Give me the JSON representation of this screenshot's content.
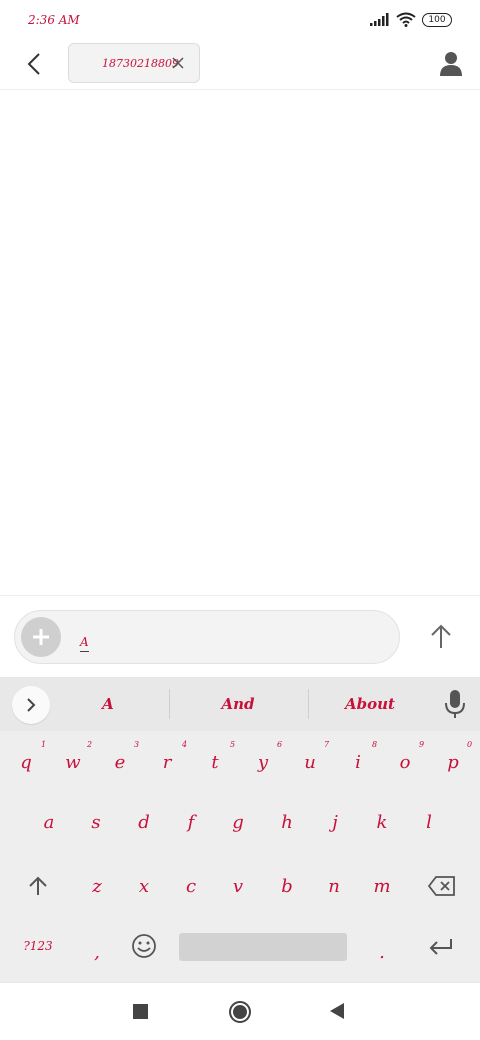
{
  "status_bar": {
    "time": "2:36 AM",
    "battery": "100",
    "icons": [
      "signal-icon",
      "wifi-icon",
      "battery-icon"
    ]
  },
  "header": {
    "recipient": "18730218809",
    "icons": [
      "back-arrow-icon",
      "close-icon",
      "contact-icon"
    ]
  },
  "compose": {
    "text": "A",
    "icons": [
      "plus-icon",
      "send-arrow-icon"
    ]
  },
  "keyboard": {
    "suggestions": [
      "A",
      "And",
      "About"
    ],
    "row1": [
      "q",
      "w",
      "e",
      "r",
      "t",
      "y",
      "u",
      "i",
      "o",
      "p"
    ],
    "row1_hints": [
      "1",
      "2",
      "3",
      "4",
      "5",
      "6",
      "7",
      "8",
      "9",
      "0"
    ],
    "row2": [
      "a",
      "s",
      "d",
      "f",
      "g",
      "h",
      "j",
      "k",
      "l"
    ],
    "row3": [
      "z",
      "x",
      "c",
      "v",
      "b",
      "n",
      "m"
    ],
    "symbols_label": "?123",
    "comma": ",",
    "period": ".",
    "icons": [
      "chevron-right-icon",
      "mic-icon",
      "shift-icon",
      "backspace-icon",
      "emoji-icon",
      "enter-icon"
    ]
  },
  "navbar": {
    "icons": [
      "recents-icon",
      "home-icon",
      "back-icon"
    ]
  },
  "colors": {
    "text_accent": "#c8103a",
    "icon": "#444444",
    "keyboard_bg": "#eeeeee"
  }
}
